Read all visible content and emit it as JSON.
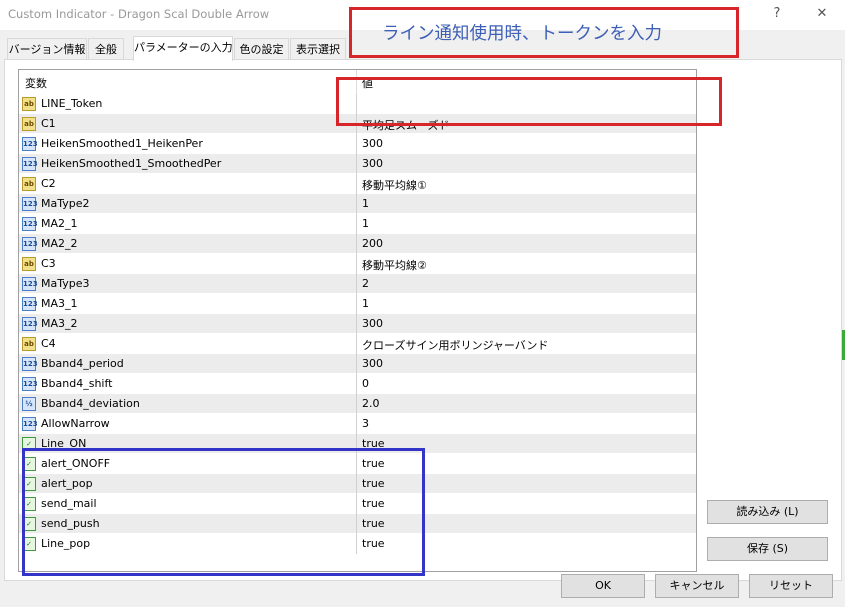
{
  "window": {
    "title": "Custom Indicator - Dragon Scal Double Arrow",
    "help_glyph": "?",
    "close_glyph": "✕"
  },
  "tabs": [
    {
      "label": "バージョン情報",
      "active": false
    },
    {
      "label": "全般",
      "active": false
    },
    {
      "label": "パラメーターの入力",
      "active": true
    },
    {
      "label": "色の設定",
      "active": false
    },
    {
      "label": "表示選択",
      "active": false
    }
  ],
  "table": {
    "col_name": "変数",
    "col_value": "値",
    "rows": [
      {
        "type": "str",
        "icon_text": "ab",
        "name": "LINE_Token",
        "value": ""
      },
      {
        "type": "str",
        "icon_text": "ab",
        "name": "C1",
        "value": "平均足スムーズド"
      },
      {
        "type": "int",
        "icon_text": "123",
        "name": "HeikenSmoothed1_HeikenPer",
        "value": "300"
      },
      {
        "type": "int",
        "icon_text": "123",
        "name": "HeikenSmoothed1_SmoothedPer",
        "value": "300"
      },
      {
        "type": "str",
        "icon_text": "ab",
        "name": "C2",
        "value": "移動平均線①"
      },
      {
        "type": "int",
        "icon_text": "123",
        "name": "MaType2",
        "value": "1"
      },
      {
        "type": "int",
        "icon_text": "123",
        "name": "MA2_1",
        "value": "1"
      },
      {
        "type": "int",
        "icon_text": "123",
        "name": "MA2_2",
        "value": "200"
      },
      {
        "type": "str",
        "icon_text": "ab",
        "name": "C3",
        "value": "移動平均線②"
      },
      {
        "type": "int",
        "icon_text": "123",
        "name": "MaType3",
        "value": "2"
      },
      {
        "type": "int",
        "icon_text": "123",
        "name": "MA3_1",
        "value": "1"
      },
      {
        "type": "int",
        "icon_text": "123",
        "name": "MA3_2",
        "value": "300"
      },
      {
        "type": "str",
        "icon_text": "ab",
        "name": "C4",
        "value": "クローズサイン用ボリンジャーバンド"
      },
      {
        "type": "int",
        "icon_text": "123",
        "name": "Bband4_period",
        "value": "300"
      },
      {
        "type": "int",
        "icon_text": "123",
        "name": "Bband4_shift",
        "value": "0"
      },
      {
        "type": "dbl",
        "icon_text": "½",
        "name": "Bband4_deviation",
        "value": "2.0"
      },
      {
        "type": "int",
        "icon_text": "123",
        "name": "AllowNarrow",
        "value": "3"
      },
      {
        "type": "bool",
        "icon_text": "✓",
        "name": "Line_ON",
        "value": "true"
      },
      {
        "type": "bool",
        "icon_text": "✓",
        "name": "alert_ONOFF",
        "value": "true"
      },
      {
        "type": "bool",
        "icon_text": "✓",
        "name": "alert_pop",
        "value": "true"
      },
      {
        "type": "bool",
        "icon_text": "✓",
        "name": "send_mail",
        "value": "true"
      },
      {
        "type": "bool",
        "icon_text": "✓",
        "name": "send_push",
        "value": "true"
      },
      {
        "type": "bool",
        "icon_text": "✓",
        "name": "Line_pop",
        "value": "true"
      }
    ]
  },
  "buttons": {
    "load": "読み込み (L)",
    "save": "保存 (S)",
    "ok": "OK",
    "cancel": "キャンセル",
    "reset": "リセット"
  },
  "annotation": {
    "callout_text": "ライン通知使用時、トークンを入力",
    "red_color": "#d6262a",
    "blue_color": "#3434c8"
  }
}
